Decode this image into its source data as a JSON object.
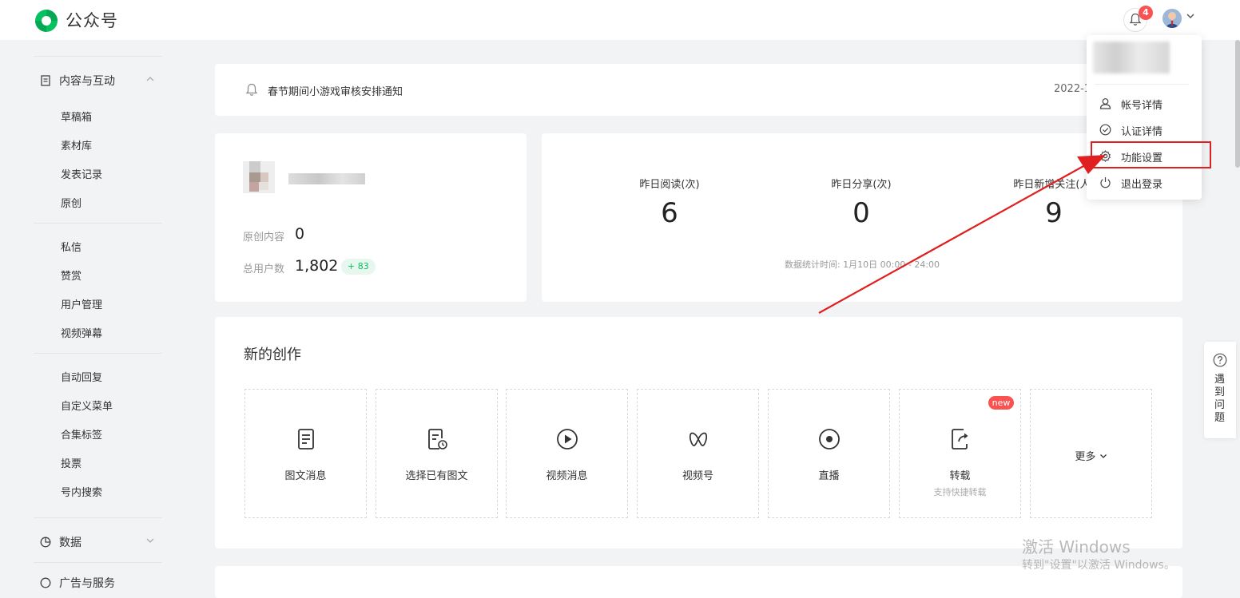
{
  "app": {
    "title": "公众号",
    "notification_count": "4"
  },
  "sidebar": {
    "groups": [
      {
        "label": "内容与互动",
        "icon": "document-icon",
        "expanded": true
      },
      {
        "label": "数据",
        "icon": "pie-chart-icon",
        "expanded": false
      },
      {
        "label": "广告与服务",
        "icon": "grid-icon",
        "expanded": false
      }
    ],
    "items": [
      "草稿箱",
      "素材库",
      "发表记录",
      "原创",
      "私信",
      "赞赏",
      "用户管理",
      "视频弹幕",
      "自动回复",
      "自定义菜单",
      "合集标签",
      "投票",
      "号内搜索"
    ]
  },
  "notice": {
    "text": "春节期间小游戏审核安排通知",
    "date": "2022-1"
  },
  "profile": {
    "original_label": "原创内容",
    "original_value": "0",
    "users_label": "总用户数",
    "users_value": "1,802",
    "users_delta": "+ 83"
  },
  "stats": {
    "items": [
      {
        "label": "昨日阅读(次)",
        "value": "6"
      },
      {
        "label": "昨日分享(次)",
        "value": "0"
      },
      {
        "label": "昨日新增关注(人)",
        "value": "9"
      }
    ],
    "note": "数据统计时间: 1月10日 00:00 - 24:00"
  },
  "creation": {
    "title": "新的创作",
    "tiles": [
      {
        "label": "图文消息",
        "icon": "article-icon"
      },
      {
        "label": "选择已有图文",
        "icon": "existing-article-icon"
      },
      {
        "label": "视频消息",
        "icon": "play-icon"
      },
      {
        "label": "视频号",
        "icon": "channels-icon"
      },
      {
        "label": "直播",
        "icon": "live-icon"
      },
      {
        "label": "转载",
        "icon": "repost-icon",
        "sub": "支持快捷转载",
        "badge": "new"
      }
    ],
    "more_label": "更多"
  },
  "account_menu": {
    "items": [
      {
        "label": "帐号详情",
        "icon": "user-icon"
      },
      {
        "label": "认证详情",
        "icon": "check-circle-icon"
      },
      {
        "label": "功能设置",
        "icon": "gear-icon",
        "highlighted": true
      },
      {
        "label": "退出登录",
        "icon": "power-icon"
      }
    ]
  },
  "help": {
    "label": "遇到问题"
  },
  "watermark": {
    "line1": "激活 Windows",
    "line2": "转到\"设置\"以激活 Windows。"
  },
  "colors": {
    "brand": "#07c160",
    "alert": "#fa5151",
    "annotation": "#e02020"
  }
}
